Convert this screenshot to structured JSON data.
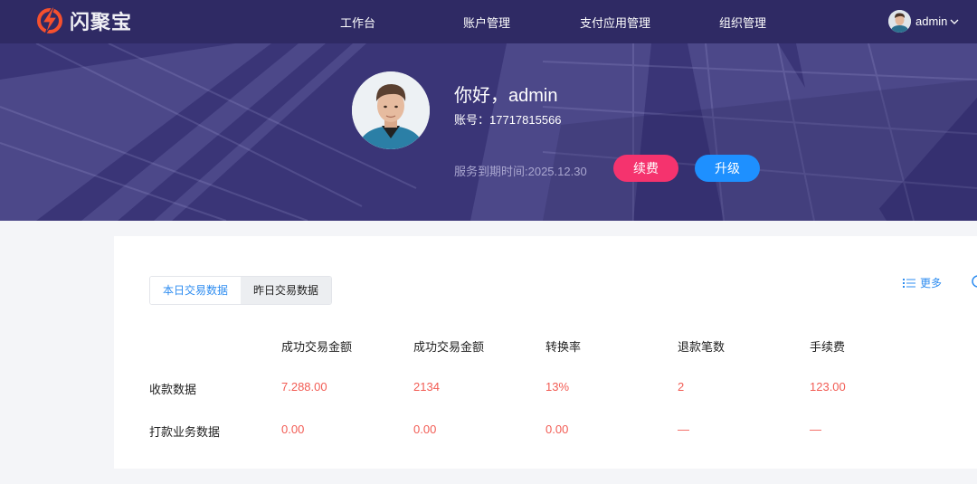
{
  "brand": {
    "name": "闪聚宝",
    "accent": "#f5502e"
  },
  "nav": {
    "items": [
      "工作台",
      "账户管理",
      "支付应用管理",
      "组织管理"
    ]
  },
  "user": {
    "name": "admin",
    "dropdown_icon": "chevron-down-icon"
  },
  "profile": {
    "greeting": "你好，admin",
    "account_line": "账号：17717815566",
    "expire_line": "服务到期时间:2025.12.30",
    "renew_label": "续费",
    "upgrade_label": "升级"
  },
  "stats": {
    "tabs": [
      {
        "label": "本日交易数据",
        "active": true
      },
      {
        "label": "昨日交易数据",
        "active": false
      }
    ],
    "more_label": "更多",
    "columns": [
      "成功交易金额",
      "成功交易金额",
      "转换率",
      "退款笔数",
      "手续费"
    ],
    "rows": [
      {
        "label": "收款数据",
        "values": [
          "7.288.00",
          "2134",
          "13%",
          "2",
          "123.00"
        ]
      },
      {
        "label": "打款业务数据",
        "values": [
          "0.00",
          "0.00",
          "0.00",
          "—",
          "—"
        ]
      }
    ]
  },
  "colors": {
    "topbar": "#2f2a64",
    "hero": "#3a3577",
    "renew_button": "#f5336e",
    "upgrade_button": "#1e90ff",
    "value_red": "#f25c54",
    "link_blue": "#2d8cf0"
  }
}
